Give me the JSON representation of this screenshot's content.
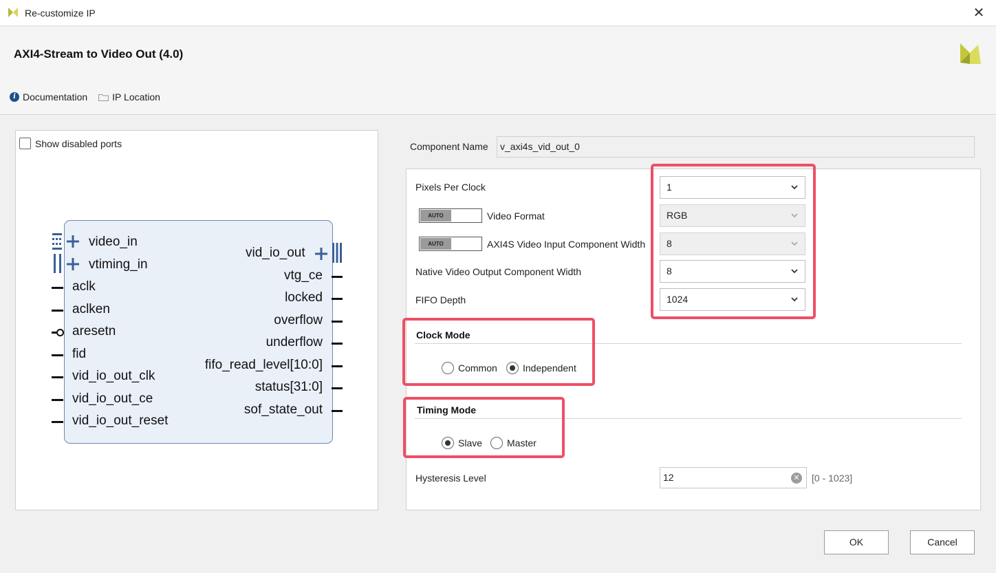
{
  "window": {
    "title": "Re-customize IP"
  },
  "header": {
    "ip_title": "AXI4-Stream to Video Out (4.0)",
    "documentation": "Documentation",
    "ip_location": "IP Location"
  },
  "symbol": {
    "show_disabled_ports": "Show disabled ports",
    "left_ports": [
      "video_in",
      "vtiming_in",
      "aclk",
      "aclken",
      "aresetn",
      "fid",
      "vid_io_out_clk",
      "vid_io_out_ce",
      "vid_io_out_reset"
    ],
    "right_ports": [
      "vid_io_out",
      "vtg_ce",
      "locked",
      "overflow",
      "underflow",
      "fifo_read_level[10:0]",
      "status[31:0]",
      "sof_state_out"
    ]
  },
  "component": {
    "label": "Component Name",
    "value": "v_axi4s_vid_out_0"
  },
  "params": {
    "pixels_per_clock": {
      "label": "Pixels Per Clock",
      "value": "1"
    },
    "video_format": {
      "label": "Video Format",
      "value": "RGB",
      "toggle": "AUTO"
    },
    "axi4s_width": {
      "label": "AXI4S Video Input Component Width",
      "value": "8",
      "toggle": "AUTO"
    },
    "native_width": {
      "label": "Native Video Output Component Width",
      "value": "8"
    },
    "fifo_depth": {
      "label": "FIFO Depth",
      "value": "1024"
    }
  },
  "clock_mode": {
    "title": "Clock Mode",
    "options": [
      "Common",
      "Independent"
    ],
    "selected": "Independent"
  },
  "timing_mode": {
    "title": "Timing Mode",
    "options": [
      "Slave",
      "Master"
    ],
    "selected": "Slave"
  },
  "hysteresis": {
    "label": "Hysteresis Level",
    "value": "12",
    "range": "[0 - 1023]"
  },
  "buttons": {
    "ok": "OK",
    "cancel": "Cancel"
  },
  "colors": {
    "highlight": "#ee4f66",
    "block_fill": "#eaf0f8",
    "block_border": "#6c86ad",
    "bus_icon": "#3a5f99"
  }
}
